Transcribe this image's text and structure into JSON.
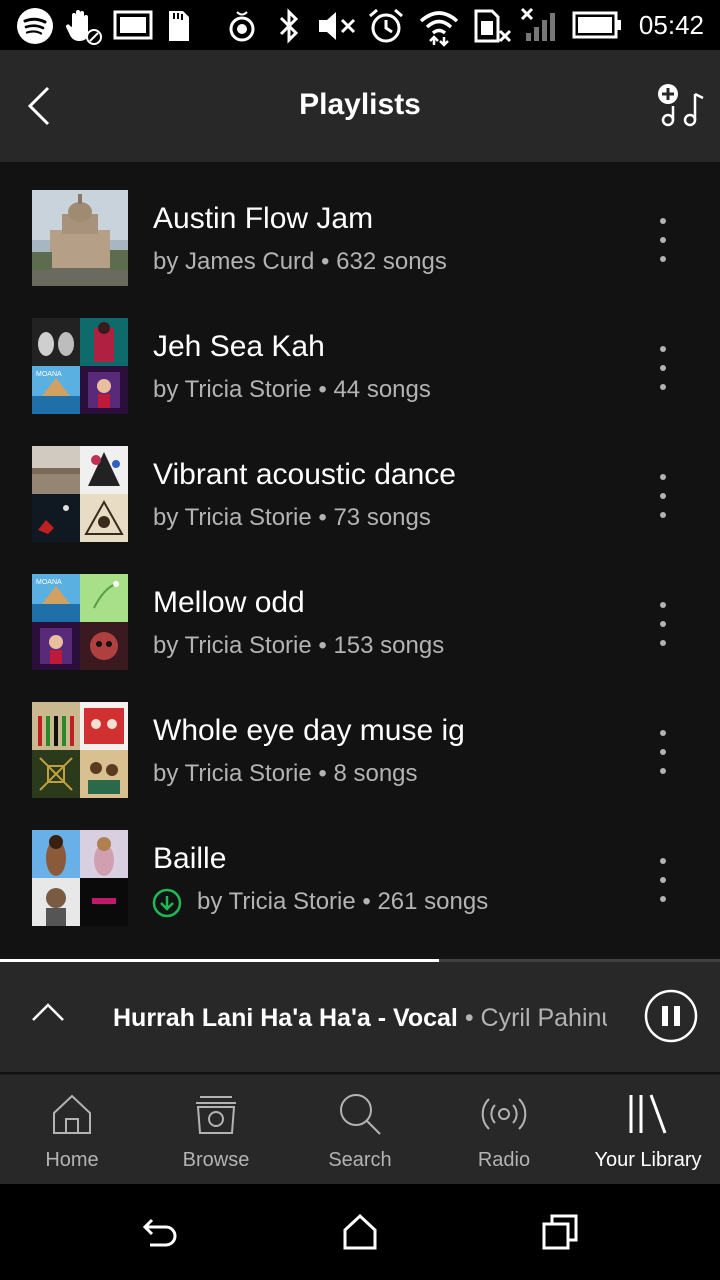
{
  "status_bar": {
    "time": "05:42"
  },
  "header": {
    "title": "Playlists"
  },
  "playlists": [
    {
      "title": "Austin Flow Jam",
      "subtitle": "by James Curd • 632 songs",
      "downloaded": false
    },
    {
      "title": "Jeh Sea Kah",
      "subtitle": "by Tricia Storie • 44 songs",
      "downloaded": false
    },
    {
      "title": "Vibrant acoustic dance",
      "subtitle": "by Tricia Storie • 73 songs",
      "downloaded": false
    },
    {
      "title": "Mellow odd",
      "subtitle": "by Tricia Storie • 153 songs",
      "downloaded": false
    },
    {
      "title": "Whole eye day muse ig",
      "subtitle": "by Tricia Storie • 8 songs",
      "downloaded": false
    },
    {
      "title": "Baille",
      "subtitle": "by Tricia Storie • 261 songs",
      "downloaded": true
    }
  ],
  "now_playing": {
    "title": "Hurrah Lani Ha'a Ha'a - Vocal",
    "separator": " • ",
    "artist": "Cyril Pahinui",
    "progress": 0.61
  },
  "bottom_nav": [
    {
      "label": "Home",
      "icon": "home-icon",
      "active": false
    },
    {
      "label": "Browse",
      "icon": "browse-icon",
      "active": false
    },
    {
      "label": "Search",
      "icon": "search-icon",
      "active": false
    },
    {
      "label": "Radio",
      "icon": "radio-icon",
      "active": false
    },
    {
      "label": "Your Library",
      "icon": "library-icon",
      "active": true
    }
  ],
  "colors": {
    "background": "#121212",
    "header": "#282828",
    "text_secondary": "#b3b3b3",
    "accent_green": "#1db954"
  }
}
